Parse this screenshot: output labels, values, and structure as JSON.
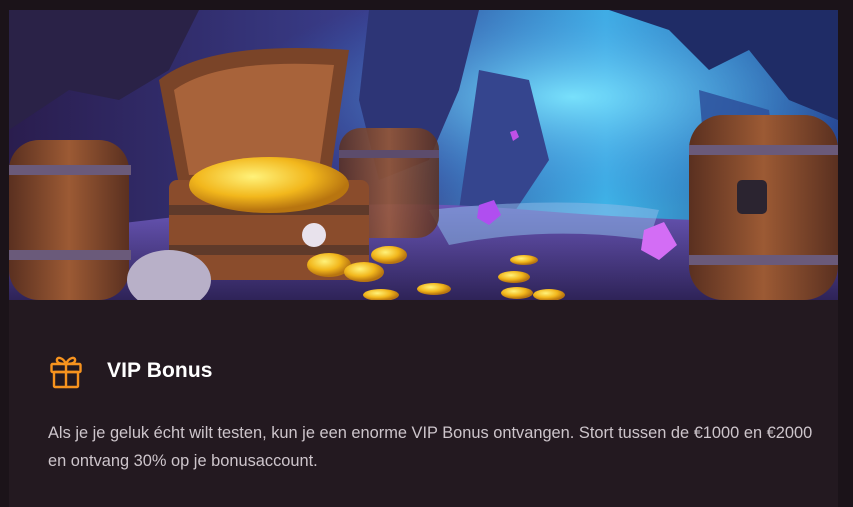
{
  "bonus_card": {
    "title": "VIP Bonus",
    "description": "Als je je geluk écht wilt testen, kun je een enorme VIP Bonus ontvangen. Stort tussen de €1000 en €2000 en ontvang 30% op je bonusaccount.",
    "icon": "gift-icon",
    "accent_color": "#f7931e"
  }
}
